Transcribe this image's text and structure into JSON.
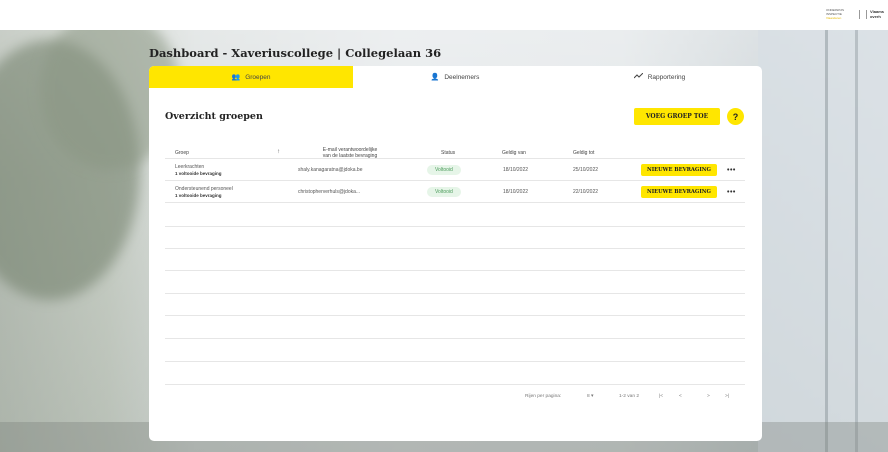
{
  "brand": {
    "logo_left_lines": [
      "ONDERWIJS",
      "INSPECTIE",
      "Vlaanderen"
    ],
    "logo_right_lines": [
      "Vlaams",
      "overh"
    ]
  },
  "page": {
    "title": "Dashboard - Xaveriuscollege | Collegelaan 36"
  },
  "tabs": [
    {
      "label": "Groepen",
      "icon": "group-icon",
      "active": true
    },
    {
      "label": "Deelnemers",
      "icon": "person-icon",
      "active": false
    },
    {
      "label": "Rapportering",
      "icon": "chart-line-icon",
      "active": false
    }
  ],
  "overview": {
    "heading": "Overzicht groepen",
    "add_group_label": "VOEG GROEP TOE",
    "help_label": "?"
  },
  "table": {
    "columns": {
      "group": "Groep",
      "email_line1": "E-mail verantwoordelijke",
      "email_line2": "van de laatste bevraging",
      "status": "Status",
      "valid_from": "Geldig van",
      "valid_to": "Geldig tot"
    },
    "rows": [
      {
        "group": "Leerkrachten",
        "sub": "1 voltooide bevraging",
        "email": "shaly.kanagaratna@jdoka.be",
        "status": "Voltooid",
        "from": "18/10/2022",
        "to": "25/10/2022",
        "action": "NIEUWE BEVRAGING",
        "more": "•••"
      },
      {
        "group": "Ondersteunend personeel",
        "sub": "1 voltooide bevraging",
        "email": "christopherverhuls@jdoka...",
        "status": "Voltooid",
        "from": "18/10/2022",
        "to": "22/10/2022",
        "action": "NIEUWE BEVRAGING",
        "more": "•••"
      }
    ]
  },
  "pagination": {
    "rows_per_page_label": "Rijen per pagina:",
    "rows_per_page_value": "8",
    "range": "1-2 van 2",
    "first": "|<",
    "prev": "<",
    "next": ">",
    "last": ">|"
  },
  "colors": {
    "accent": "#ffe600",
    "success_bg": "#e6f5e8",
    "success_text": "#4a9b5a"
  }
}
